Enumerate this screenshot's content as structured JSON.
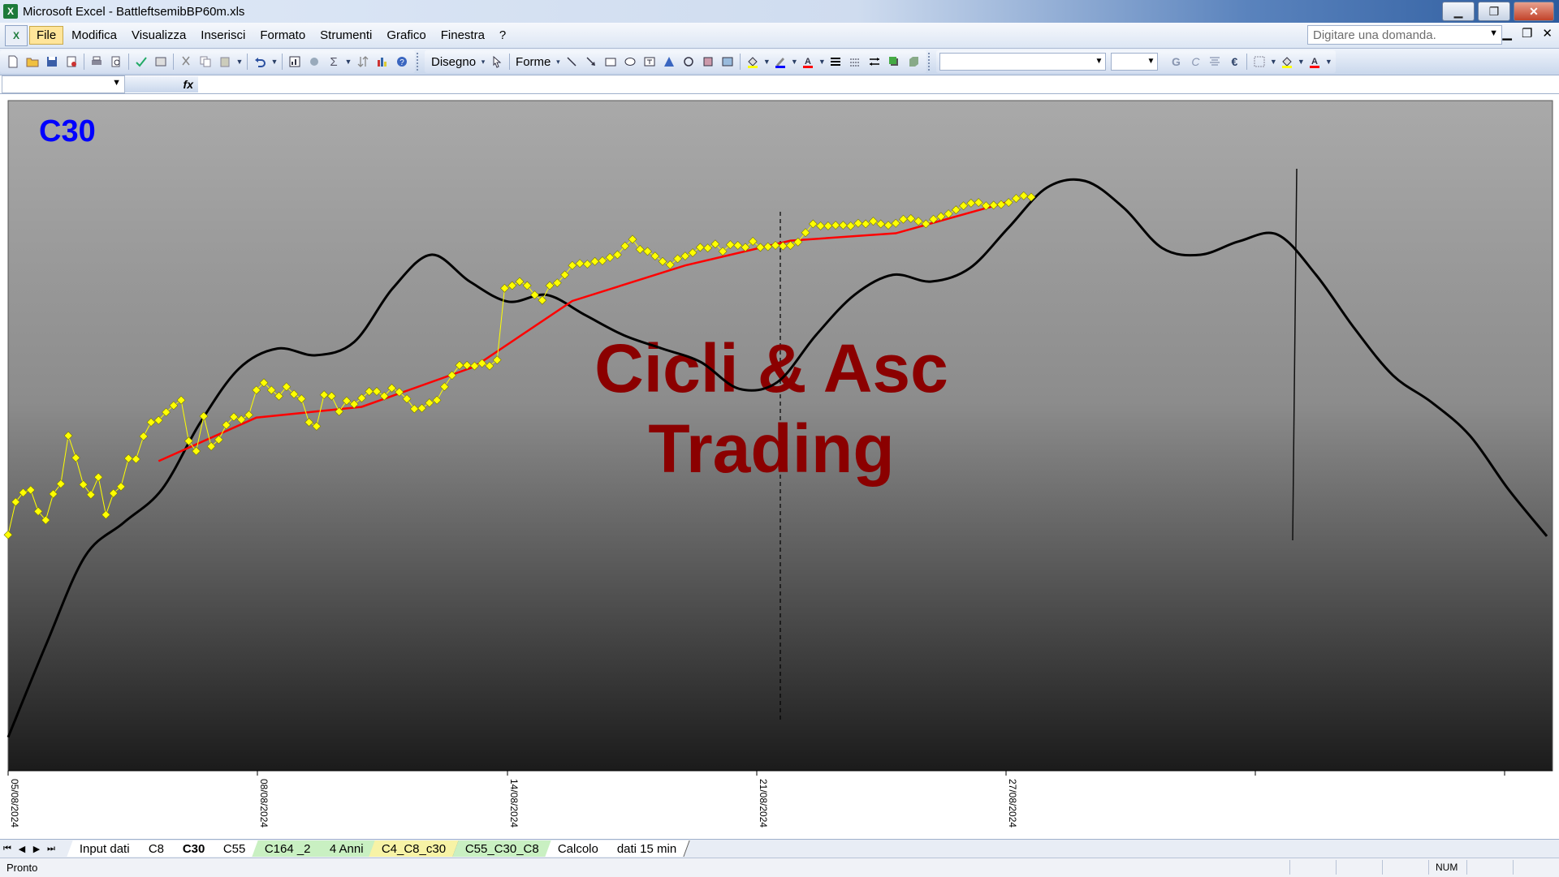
{
  "window": {
    "app_title": "Microsoft Excel - BattleftsemibBP60m.xls",
    "minimize_label": "▁",
    "maximize_label": "❐",
    "close_label": "✕"
  },
  "menu": {
    "items": [
      "File",
      "Modifica",
      "Visualizza",
      "Inserisci",
      "Formato",
      "Strumenti",
      "Grafico",
      "Finestra",
      "?"
    ],
    "active_index": 0,
    "question_placeholder": "Digitare una domanda."
  },
  "toolbar": {
    "draw_label": "Disegno",
    "shapes_label": "Forme",
    "bold_label": "G",
    "italic_label": "C"
  },
  "formula_bar": {
    "fx_label": "fx"
  },
  "chart": {
    "label": "C30",
    "watermark_line1": "Cicli & Asc",
    "watermark_line2": "Trading",
    "label_color": "#0000ff",
    "watermark_color": "#8b0000",
    "price_color": "#ffff00",
    "moving_average_color": "#ff0000",
    "cycle_color": "#000000",
    "x_tick_labels": [
      "05/08/2024",
      "08/08/2024",
      "14/08/2024",
      "21/08/2024",
      "27/08/2024"
    ]
  },
  "chart_data": {
    "type": "line",
    "x_tick_labels": [
      "05/08/2024",
      "08/08/2024",
      "14/08/2024",
      "21/08/2024",
      "27/08/2024"
    ],
    "y_range": [
      0,
      100
    ],
    "grid": false,
    "legend": "none",
    "series": [
      {
        "style": "line-with-diamond-markers",
        "color": "#ffff00",
        "x": [
          0,
          1,
          2,
          3,
          4,
          5,
          6,
          7,
          8,
          9,
          10,
          11,
          12,
          13,
          14,
          15,
          16,
          17,
          18,
          19,
          20,
          21,
          22,
          23,
          24,
          25,
          26,
          27,
          28,
          29,
          30,
          31,
          32,
          33,
          34,
          35,
          36,
          37,
          38,
          39,
          40,
          41,
          42,
          43,
          44,
          45,
          46,
          47,
          48,
          49,
          50,
          51,
          52,
          53,
          54,
          55,
          56,
          57,
          58,
          59,
          60,
          61,
          62,
          63,
          64,
          65,
          66,
          67,
          68,
          69,
          70,
          71,
          72,
          73,
          74,
          75,
          76,
          77,
          78,
          79,
          80,
          81,
          82,
          83,
          84,
          85,
          86,
          87,
          88,
          89,
          90,
          91,
          92,
          93,
          94,
          95,
          96,
          97,
          98,
          99,
          100,
          101,
          102,
          103,
          104,
          105,
          106,
          107,
          108,
          109,
          110,
          111,
          112,
          113,
          114,
          115,
          116,
          117,
          118,
          119,
          120,
          121,
          122,
          123,
          124,
          125,
          126,
          127,
          128,
          129,
          130,
          131,
          132,
          133,
          134,
          135,
          136
        ],
        "values": [
          35.2,
          40.1,
          41.5,
          41.9,
          38.7,
          37.4,
          41.3,
          42.8,
          50.0,
          46.7,
          42.7,
          41.2,
          43.8,
          38.2,
          41.4,
          42.4,
          46.6,
          46.5,
          49.9,
          52.0,
          52.3,
          53.5,
          54.5,
          55.3,
          49.2,
          47.7,
          52.9,
          48.4,
          49.4,
          51.6,
          52.8,
          52.4,
          53.1,
          56.8,
          57.9,
          56.8,
          55.9,
          57.3,
          56.2,
          55.5,
          52.0,
          51.4,
          56.1,
          55.9,
          53.6,
          55.2,
          54.7,
          55.6,
          56.6,
          56.6,
          55.9,
          57.1,
          56.5,
          55.5,
          54.0,
          54.1,
          54.9,
          55.3,
          57.3,
          59.0,
          60.5,
          60.5,
          60.4,
          60.8,
          60.4,
          61.3,
          72.0,
          72.4,
          73.0,
          72.4,
          71.0,
          70.2,
          72.4,
          72.8,
          74.0,
          75.4,
          75.7,
          75.6,
          76.0,
          76.1,
          76.6,
          77.0,
          78.3,
          79.3,
          77.8,
          77.5,
          76.8,
          76.0,
          75.5,
          76.4,
          76.8,
          77.3,
          78.1,
          78.0,
          78.6,
          77.5,
          78.5,
          78.4,
          78.1,
          79.0,
          78.1,
          78.2,
          78.4,
          78.3,
          78.4,
          78.9,
          80.3,
          81.6,
          81.3,
          81.3,
          81.4,
          81.4,
          81.3,
          81.7,
          81.6,
          82.0,
          81.6,
          81.4,
          81.7,
          82.3,
          82.4,
          82.0,
          81.6,
          82.3,
          82.7,
          83.1,
          83.7,
          84.3,
          84.7,
          84.8,
          84.3,
          84.4,
          84.5,
          84.8,
          85.4,
          85.8,
          85.6
        ]
      },
      {
        "style": "line",
        "color": "#ff0000",
        "x": [
          20,
          33,
          47,
          62,
          75,
          90,
          104,
          118,
          133
        ],
        "values": [
          46.2,
          52.7,
          54.3,
          60.3,
          70.1,
          75.4,
          79.1,
          80.2,
          84.9
        ]
      },
      {
        "style": "smooth-line",
        "color": "#000000",
        "x": [
          0,
          5,
          10,
          15,
          20,
          25,
          30,
          35,
          40,
          45,
          50,
          55,
          60,
          65,
          70,
          75,
          80,
          85,
          90,
          95,
          100,
          105,
          110,
          115,
          120,
          125,
          130,
          135,
          140,
          145,
          150,
          155,
          160,
          165,
          170,
          175,
          180,
          185,
          190,
          195,
          200
        ],
        "values": [
          5,
          19,
          32,
          37,
          42,
          52,
          60,
          63,
          62,
          64,
          72,
          77,
          73,
          70,
          71,
          68,
          65,
          63,
          61,
          57,
          58,
          65,
          71,
          74,
          73,
          75,
          81,
          87,
          88,
          84,
          78,
          77,
          79,
          80,
          74,
          66,
          59,
          55,
          50,
          42,
          35
        ]
      }
    ]
  },
  "sheet_tabs": [
    {
      "label": "Input dati",
      "style": "plain"
    },
    {
      "label": "C8",
      "style": "plain"
    },
    {
      "label": "C30",
      "style": "active"
    },
    {
      "label": "C55",
      "style": "plain"
    },
    {
      "label": "C164 _2",
      "style": "green"
    },
    {
      "label": "4 Anni",
      "style": "green"
    },
    {
      "label": "C4_C8_c30",
      "style": "yellow"
    },
    {
      "label": "C55_C30_C8",
      "style": "green"
    },
    {
      "label": "Calcolo",
      "style": "plain"
    },
    {
      "label": "dati 15 min",
      "style": "plain"
    }
  ],
  "statusbar": {
    "status_text": "Pronto",
    "num_label": "NUM"
  }
}
